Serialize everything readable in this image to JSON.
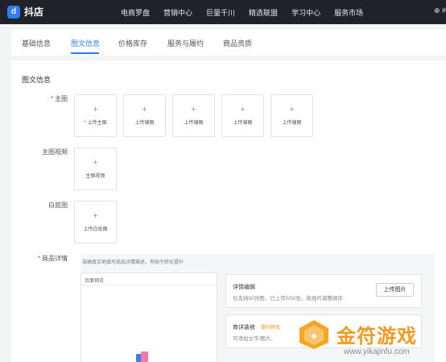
{
  "header": {
    "logo_glyph": "d",
    "app_name": "抖店",
    "nav": [
      "电商罗盘",
      "营销中心",
      "巨量千川",
      "精选联盟",
      "学习中心",
      "服务市场"
    ],
    "right_text": "⊕ #"
  },
  "tabs": [
    {
      "label": "基础信息",
      "active": false
    },
    {
      "label": "图文信息",
      "active": true
    },
    {
      "label": "价格库存",
      "active": false
    },
    {
      "label": "服务与履约",
      "active": false
    },
    {
      "label": "商品资质",
      "active": false
    }
  ],
  "section_title": "图文信息",
  "main_image": {
    "label": "主图",
    "required": true,
    "slots": [
      "上传主图",
      "上传辅图",
      "上传辅图",
      "上传辅图",
      "上传辅图"
    ],
    "first_slot_required": true
  },
  "main_video": {
    "label": "主图视频",
    "slot": "主图视频"
  },
  "white_bg": {
    "label": "白底图",
    "slot": "上传白底图"
  },
  "detail": {
    "label": "商品详情",
    "required": true,
    "hint": "准确真实地填写商品详情描述，有助于转化提升",
    "preview_title": "页面预览",
    "edit": {
      "title": "详情编辑",
      "desc": "仅支持50张图，已上传0/50张，拖拽可调整顺序",
      "upload_button": "上传图片"
    },
    "decor": {
      "title": "商详装修",
      "tag": "提升转化",
      "desc": "可添加文字/图片。"
    }
  },
  "watermark": {
    "title": "金符游戏",
    "url": "www.yikajinfu.com"
  },
  "colors": {
    "topbar": "#1f2329",
    "accent": "#2f7cf6",
    "required": "#e3403a",
    "watermark": "#f39a1e"
  }
}
